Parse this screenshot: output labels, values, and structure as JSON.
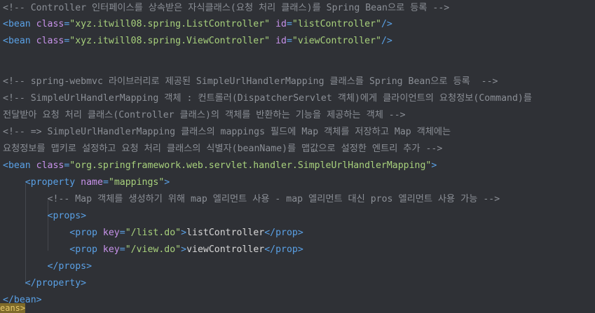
{
  "editor": {
    "lines": [
      {
        "parts": [
          {
            "t": "comment",
            "v": "<!-- Controller 인터페이스를 상속받은 자식클래스(요청 처리 클래스)를 Spring Bean으로 등록 -->"
          }
        ]
      },
      {
        "parts": [
          {
            "t": "tag",
            "v": "<bean "
          },
          {
            "t": "attr",
            "v": "class"
          },
          {
            "t": "pun",
            "v": "="
          },
          {
            "t": "val",
            "v": "\"xyz.itwill08.spring.ListController\""
          },
          {
            "t": "txt",
            "v": " "
          },
          {
            "t": "attr",
            "v": "id"
          },
          {
            "t": "pun",
            "v": "="
          },
          {
            "t": "val",
            "v": "\"listController\""
          },
          {
            "t": "tag",
            "v": "/>"
          }
        ]
      },
      {
        "parts": [
          {
            "t": "tag",
            "v": "<bean "
          },
          {
            "t": "attr",
            "v": "class"
          },
          {
            "t": "pun",
            "v": "="
          },
          {
            "t": "val",
            "v": "\"xyz.itwill08.spring.ViewController\""
          },
          {
            "t": "txt",
            "v": " "
          },
          {
            "t": "attr",
            "v": "id"
          },
          {
            "t": "pun",
            "v": "="
          },
          {
            "t": "val",
            "v": "\"viewController\""
          },
          {
            "t": "tag",
            "v": "/>"
          }
        ]
      },
      {
        "parts": []
      },
      {
        "parts": [
          {
            "t": "comment",
            "v": "<!-- spring-webmvc 라이브러리로 제공된 SimpleUrlHandlerMapping 클래스를 Spring Bean으로 등록  -->"
          }
        ]
      },
      {
        "parts": [
          {
            "t": "comment",
            "v": "<!-- SimpleUrlHandlerMapping 객체 : 컨트롤러(DispatcherServlet 객체)에게 클라이언트의 요청정보(Command)를"
          }
        ]
      },
      {
        "parts": [
          {
            "t": "comment",
            "v": "전달받아 요청 처리 클래스(Controller 클래스)의 객체를 반환하는 기능을 제공하는 객체 -->"
          }
        ]
      },
      {
        "parts": [
          {
            "t": "comment",
            "v": "<!-- => SimpleUrlHandlerMapping 클래스의 mappings 필드에 Map 객체를 저장하고 Map 객체에는"
          }
        ]
      },
      {
        "parts": [
          {
            "t": "comment",
            "v": "요청정보를 맵키로 설정하고 요청 처리 클래스의 식별자(beanName)를 맵값으로 설정한 엔트리 추가 -->"
          }
        ]
      },
      {
        "parts": [
          {
            "t": "tag",
            "v": "<bean "
          },
          {
            "t": "attr",
            "v": "class"
          },
          {
            "t": "pun",
            "v": "="
          },
          {
            "t": "val",
            "v": "\"org.springframework.web.servlet.handler.SimpleUrlHandlerMapping\""
          },
          {
            "t": "tag",
            "v": ">"
          }
        ]
      },
      {
        "parts": [
          {
            "t": "txt",
            "v": "    "
          },
          {
            "t": "tag",
            "v": "<property "
          },
          {
            "t": "attr",
            "v": "name"
          },
          {
            "t": "pun",
            "v": "="
          },
          {
            "t": "val",
            "v": "\"mappings\""
          },
          {
            "t": "tag",
            "v": ">"
          }
        ]
      },
      {
        "parts": [
          {
            "t": "txt",
            "v": "        "
          },
          {
            "t": "comment",
            "v": "<!-- Map 객체를 생성하기 위해 map 엘리먼트 사용 - map 엘리먼트 대신 pros 엘리먼트 사용 가능 -->"
          }
        ]
      },
      {
        "parts": [
          {
            "t": "txt",
            "v": "        "
          },
          {
            "t": "tag",
            "v": "<props>"
          }
        ]
      },
      {
        "parts": [
          {
            "t": "txt",
            "v": "            "
          },
          {
            "t": "tag",
            "v": "<prop "
          },
          {
            "t": "attr",
            "v": "key"
          },
          {
            "t": "pun",
            "v": "="
          },
          {
            "t": "val",
            "v": "\"/list.do\""
          },
          {
            "t": "tag",
            "v": ">"
          },
          {
            "t": "txt",
            "v": "listController"
          },
          {
            "t": "tag",
            "v": "</prop>"
          }
        ]
      },
      {
        "parts": [
          {
            "t": "txt",
            "v": "            "
          },
          {
            "t": "tag",
            "v": "<prop "
          },
          {
            "t": "attr",
            "v": "key"
          },
          {
            "t": "pun",
            "v": "="
          },
          {
            "t": "val",
            "v": "\"/view.do\""
          },
          {
            "t": "tag",
            "v": ">"
          },
          {
            "t": "txt",
            "v": "viewController"
          },
          {
            "t": "tag",
            "v": "</prop>"
          }
        ]
      },
      {
        "parts": [
          {
            "t": "txt",
            "v": "        "
          },
          {
            "t": "tag",
            "v": "</props>"
          }
        ]
      },
      {
        "parts": [
          {
            "t": "txt",
            "v": "    "
          },
          {
            "t": "tag",
            "v": "</property>"
          }
        ]
      },
      {
        "parts": [
          {
            "t": "tag",
            "v": "</bean>"
          }
        ]
      }
    ],
    "bottom_fragment": "eans>"
  }
}
